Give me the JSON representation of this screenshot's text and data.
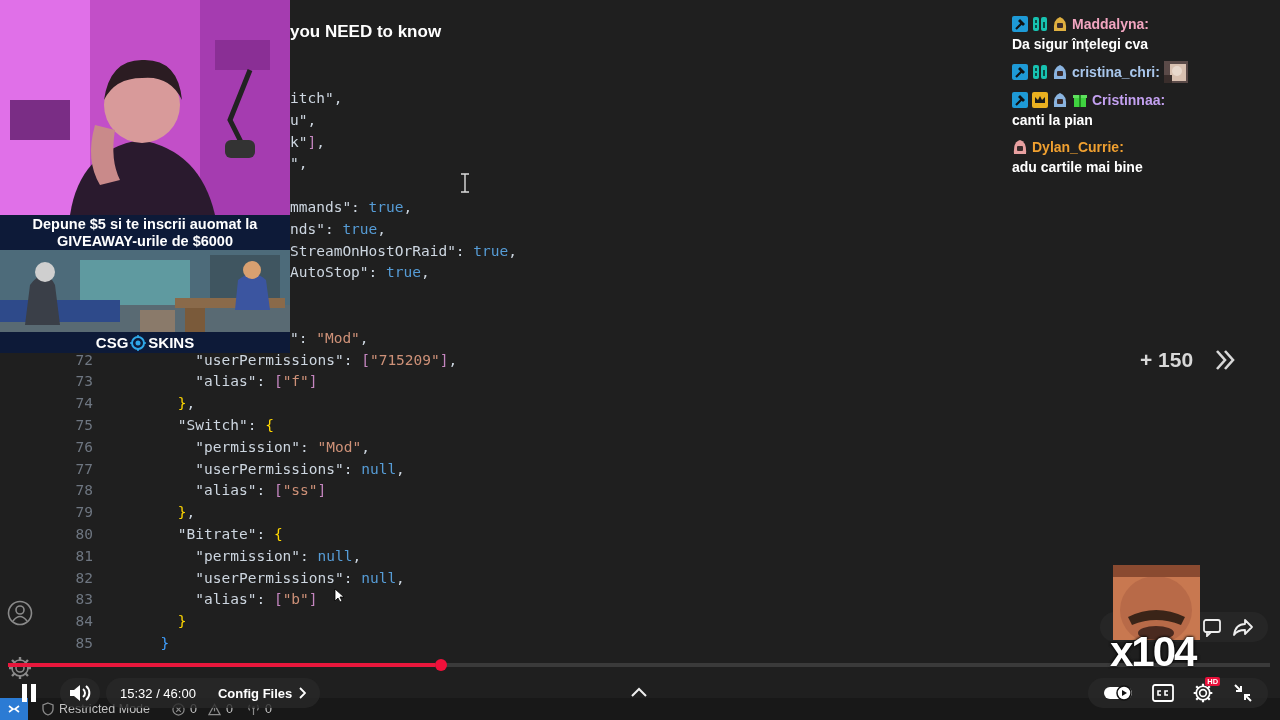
{
  "stream_overlay": {
    "banner": "Depune **$5** si te inscrii auomat la GIVEAWAY-urile de **$6000**",
    "logo": {
      "left": "CSG",
      "right": "SKINS"
    }
  },
  "video_title": "you NEED to know",
  "editor": {
    "lines": [
      {
        "kind": "cut",
        "text": "itch\","
      },
      {
        "kind": "cut",
        "text": "u\","
      },
      {
        "kind": "cut",
        "text": "k\"],"
      },
      {
        "kind": "cut",
        "text": "\","
      },
      {
        "kind": "blank"
      },
      {
        "kind": "cut",
        "text": "mmands\": true,"
      },
      {
        "kind": "cut",
        "text": "nds\": true,"
      },
      {
        "kind": "cut",
        "text": "StreamOnHostOrRaid\": true,"
      },
      {
        "kind": "cut",
        "text": "AutoStop\": true,"
      },
      {
        "kind": "blank"
      },
      {
        "kind": "blank"
      },
      {
        "kind": "cut",
        "text": "\": \"Mod\","
      },
      {
        "kind": "code",
        "number": "72",
        "text": "          \"userPermissions\": [\"715209\"],"
      },
      {
        "kind": "code",
        "number": "73",
        "text": "          \"alias\": [\"f\"]"
      },
      {
        "kind": "code",
        "number": "74",
        "text": "        },"
      },
      {
        "kind": "code",
        "number": "75",
        "text": "        \"Switch\": {"
      },
      {
        "kind": "code",
        "number": "76",
        "text": "          \"permission\": \"Mod\","
      },
      {
        "kind": "code",
        "number": "77",
        "text": "          \"userPermissions\": null,"
      },
      {
        "kind": "code",
        "number": "78",
        "text": "          \"alias\": [\"ss\"]"
      },
      {
        "kind": "code",
        "number": "79",
        "text": "        },"
      },
      {
        "kind": "code",
        "number": "80",
        "text": "        \"Bitrate\": {"
      },
      {
        "kind": "code",
        "number": "81",
        "text": "          \"permission\": null,"
      },
      {
        "kind": "code",
        "number": "82",
        "text": "          \"userPermissions\": null,"
      },
      {
        "kind": "code",
        "number": "83",
        "text": "          \"alias\": [\"b\"]"
      },
      {
        "kind": "code",
        "number": "84",
        "text": "        }"
      },
      {
        "kind": "code",
        "number": "85",
        "text": "      }"
      }
    ]
  },
  "chat": [
    {
      "badges": [
        {
          "kind": "mod"
        },
        {
          "kind": "sub"
        },
        {
          "kind": "creature",
          "color": "#e0b040"
        }
      ],
      "user": "Maddalyna:",
      "color": "#f2a5c0",
      "kind": "text",
      "message": "Da sigur înțelegi cva"
    },
    {
      "badges": [
        {
          "kind": "mod"
        },
        {
          "kind": "sub"
        },
        {
          "kind": "creature",
          "color": "#8ab4e0"
        }
      ],
      "user": "cristina_chri:",
      "color": "#a9c7ec",
      "kind": "emote"
    },
    {
      "badges": [
        {
          "kind": "mod"
        },
        {
          "kind": "crown"
        },
        {
          "kind": "creature",
          "color": "#8ab4e0"
        },
        {
          "kind": "gift"
        }
      ],
      "user": "Cristinnaa:",
      "color": "#c3a0f0",
      "kind": "text",
      "message": "canti la pian"
    },
    {
      "badges": [
        {
          "kind": "creature",
          "color": "#e8a0a0"
        }
      ],
      "user": "Dylan_Currie:",
      "color": "#f0a030",
      "kind": "text",
      "message": "adu cartile mai bine"
    }
  ],
  "skip_forward": "+ 150",
  "emote_counter": "x104",
  "player": {
    "progress": {
      "level": 0.338
    },
    "time": "15:32 / 46:00",
    "chapter": "Config Files",
    "autoplay": {
      "on": true
    },
    "quality_badge": "HD"
  },
  "status_bar": {
    "mode": "Restricted Mode",
    "errors": "0",
    "warnings": "0",
    "ports": "0"
  }
}
